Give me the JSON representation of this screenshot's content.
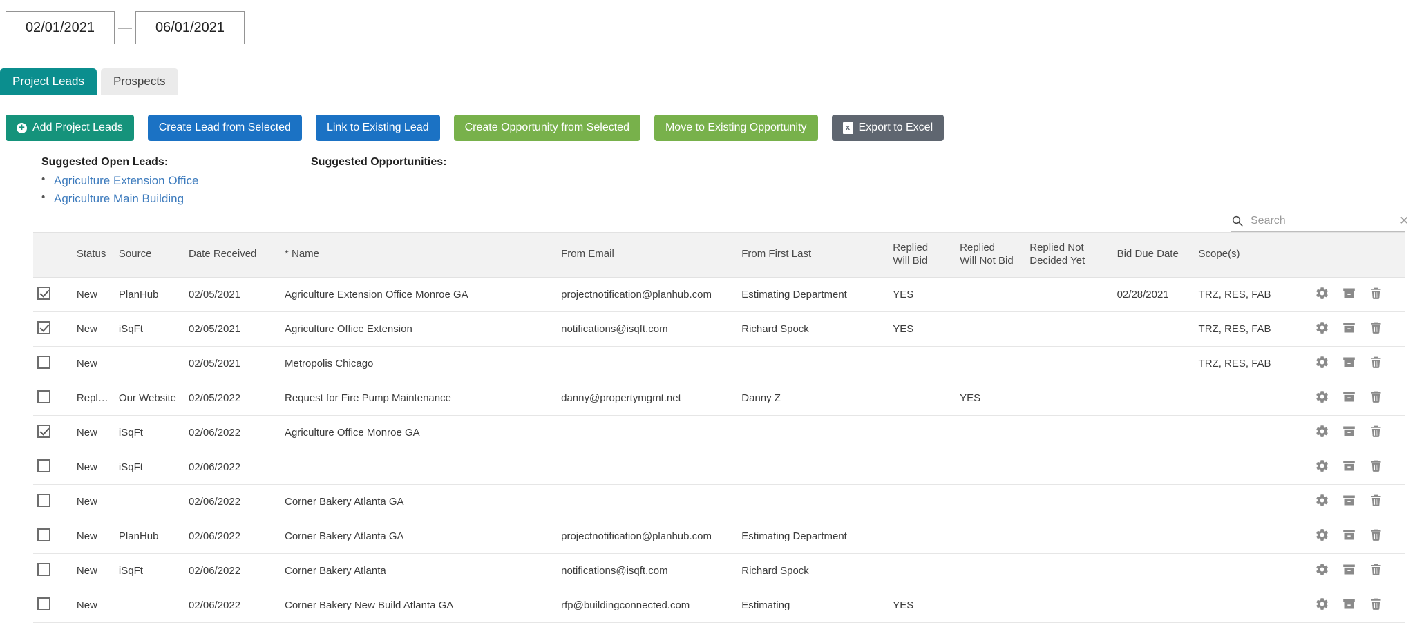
{
  "date_range": {
    "start": "02/01/2021",
    "separator": "—",
    "end": "06/01/2021"
  },
  "tabs": [
    {
      "label": "Project Leads",
      "active": true
    },
    {
      "label": "Prospects",
      "active": false
    }
  ],
  "toolbar": {
    "add_project_leads": "Add Project Leads",
    "create_lead_from_selected": "Create Lead from Selected",
    "link_to_existing_lead": "Link to Existing Lead",
    "create_opportunity_from_selected": "Create Opportunity from Selected",
    "move_to_existing_opportunity": "Move to Existing Opportunity",
    "export_to_excel": "Export to Excel",
    "plus_glyph": "+",
    "excel_glyph": "x"
  },
  "suggestions": {
    "open_leads_title": "Suggested Open Leads:",
    "open_leads": [
      "Agriculture Extension Office",
      "Agriculture Main Building"
    ],
    "opportunities_title": "Suggested Opportunities:",
    "opportunities": []
  },
  "search": {
    "value": "",
    "placeholder": "Search",
    "clear_glyph": "✕"
  },
  "table": {
    "columns": [
      "",
      "Status",
      "Source",
      "Date Received",
      "* Name",
      "From Email",
      "From First Last",
      "Replied\nWill Bid",
      "Replied\nWill Not Bid",
      "Replied Not\nDecided Yet",
      "Bid Due Date",
      "Scope(s)",
      ""
    ],
    "columns_multiline": {
      "replied_will_bid": [
        "Replied",
        "Will Bid"
      ],
      "replied_will_not_bid": [
        "Replied",
        "Will Not Bid"
      ],
      "replied_not_decided_yet": [
        "Replied Not",
        "Decided Yet"
      ]
    },
    "rows": [
      {
        "checked": true,
        "status": "New",
        "source": "PlanHub",
        "date_received": "02/05/2021",
        "name": "Agriculture Extension Office Monroe GA",
        "from_email": "projectnotification@planhub.com",
        "from_first_last": "Estimating Department",
        "replied_will_bid": "YES",
        "replied_will_not_bid": "",
        "replied_not_decided_yet": "",
        "bid_due_date": "02/28/2021",
        "scopes": "TRZ, RES, FAB"
      },
      {
        "checked": true,
        "status": "New",
        "source": "iSqFt",
        "date_received": "02/05/2021",
        "name": "Agriculture Office Extension",
        "from_email": "notifications@isqft.com",
        "from_first_last": "Richard Spock",
        "replied_will_bid": "YES",
        "replied_will_not_bid": "",
        "replied_not_decided_yet": "",
        "bid_due_date": "",
        "scopes": "TRZ, RES, FAB"
      },
      {
        "checked": false,
        "status": "New",
        "source": "",
        "date_received": "02/05/2021",
        "name": "Metropolis Chicago",
        "from_email": "",
        "from_first_last": "",
        "replied_will_bid": "",
        "replied_will_not_bid": "",
        "replied_not_decided_yet": "",
        "bid_due_date": "",
        "scopes": "TRZ, RES, FAB"
      },
      {
        "checked": false,
        "status": "Replied",
        "source": "Our Website",
        "date_received": "02/05/2022",
        "name": "Request for Fire Pump Maintenance",
        "from_email": "danny@propertymgmt.net",
        "from_first_last": "Danny Z",
        "replied_will_bid": "",
        "replied_will_not_bid": "YES",
        "replied_not_decided_yet": "",
        "bid_due_date": "",
        "scopes": ""
      },
      {
        "checked": true,
        "status": "New",
        "source": "iSqFt",
        "date_received": "02/06/2022",
        "name": "Agriculture Office Monroe GA",
        "from_email": "",
        "from_first_last": "",
        "replied_will_bid": "",
        "replied_will_not_bid": "",
        "replied_not_decided_yet": "",
        "bid_due_date": "",
        "scopes": ""
      },
      {
        "checked": false,
        "status": "New",
        "source": "iSqFt",
        "date_received": "02/06/2022",
        "name": "",
        "from_email": "",
        "from_first_last": "",
        "replied_will_bid": "",
        "replied_will_not_bid": "",
        "replied_not_decided_yet": "",
        "bid_due_date": "",
        "scopes": ""
      },
      {
        "checked": false,
        "status": "New",
        "source": "",
        "date_received": "02/06/2022",
        "name": "Corner Bakery Atlanta GA",
        "from_email": "",
        "from_first_last": "",
        "replied_will_bid": "",
        "replied_will_not_bid": "",
        "replied_not_decided_yet": "",
        "bid_due_date": "",
        "scopes": ""
      },
      {
        "checked": false,
        "status": "New",
        "source": "PlanHub",
        "date_received": "02/06/2022",
        "name": "Corner Bakery Atlanta GA",
        "from_email": "projectnotification@planhub.com",
        "from_first_last": "Estimating Department",
        "replied_will_bid": "",
        "replied_will_not_bid": "",
        "replied_not_decided_yet": "",
        "bid_due_date": "",
        "scopes": ""
      },
      {
        "checked": false,
        "status": "New",
        "source": "iSqFt",
        "date_received": "02/06/2022",
        "name": "Corner Bakery Atlanta",
        "from_email": "notifications@isqft.com",
        "from_first_last": "Richard Spock",
        "replied_will_bid": "",
        "replied_will_not_bid": "",
        "replied_not_decided_yet": "",
        "bid_due_date": "",
        "scopes": ""
      },
      {
        "checked": false,
        "status": "New",
        "source": "",
        "date_received": "02/06/2022",
        "name": "Corner Bakery New Build Atlanta GA",
        "from_email": "rfp@buildingconnected.com",
        "from_first_last": "Estimating",
        "replied_will_bid": "YES",
        "replied_will_not_bid": "",
        "replied_not_decided_yet": "",
        "bid_due_date": "",
        "scopes": ""
      }
    ],
    "row_actions": [
      "settings-gear",
      "archive-box",
      "delete-trash"
    ]
  },
  "colors": {
    "tab_active": "#0b8e8e",
    "btn_teal": "#15937b",
    "btn_blue": "#1b72c4",
    "btn_green": "#78b14b",
    "btn_gray": "#5f6670",
    "link": "#3d7bbd"
  }
}
